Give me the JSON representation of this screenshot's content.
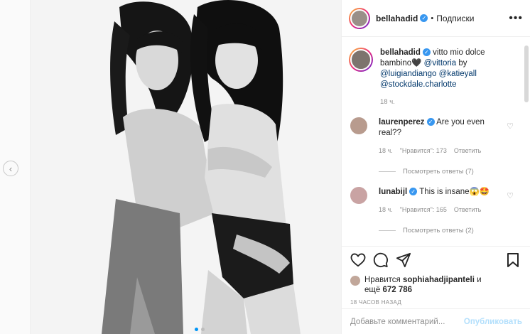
{
  "post": {
    "author": "bellahadid",
    "follow_label": "Подписки",
    "bullet": "•",
    "more_label": "•••",
    "image_alt": ""
  },
  "caption": {
    "author": "bellahadid",
    "text": "vitto mio dolce bambino🖤 ",
    "mentions": [
      "@vittoria",
      "by",
      "@luigiandiango",
      "@katieyall",
      "@stockdale.charlotte"
    ],
    "time": "18 ч."
  },
  "comments": [
    {
      "author": "laurenperez",
      "text": "Are you even real??",
      "time": "18 ч.",
      "likes": "\"Нравится\": 173",
      "reply": "Ответить",
      "view_replies": "Посмотреть ответы (7)"
    },
    {
      "author": "lunabijl",
      "text": "This is insane😱🤩",
      "time": "18 ч.",
      "likes": "\"Нравится\": 165",
      "reply": "Ответить",
      "view_replies": "Посмотреть ответы (2)"
    }
  ],
  "likes": {
    "prefix": "Нравится",
    "user": "sophiahadjipanteli",
    "and": "и",
    "rest_prefix": "ещё",
    "count": "672 786"
  },
  "timestamp": "18 ЧАСОВ НАЗАД",
  "add_comment": {
    "placeholder": "Добавьте комментарий...",
    "publish": "Опубликовать"
  },
  "carousel": {
    "total": 2,
    "active": 0
  },
  "colors": {
    "accent": "#0095f6",
    "mention": "#00376b",
    "verified": "#3897f0",
    "muted": "#8e8e8e"
  },
  "icons": [
    "chevron-left-icon",
    "more-icon",
    "verified-icon",
    "heart-icon",
    "comment-icon",
    "share-icon",
    "bookmark-icon"
  ]
}
